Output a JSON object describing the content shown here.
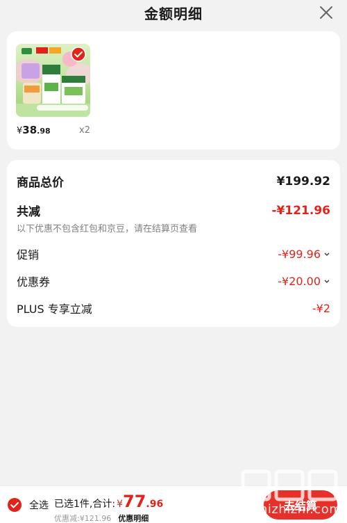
{
  "header": {
    "title": "金额明细"
  },
  "product": {
    "price_currency": "¥",
    "price_int": "38",
    "price_dec": ".98",
    "quantity": "x2"
  },
  "breakdown": {
    "total_label": "商品总价",
    "total_value": "¥199.92",
    "reduce_label": "共减",
    "reduce_value": "-¥121.96",
    "note": "以下优惠不包含红包和京豆，请在结算页查看",
    "promo_label": "促销",
    "promo_value": "-¥99.96",
    "coupon_label": "优惠券",
    "coupon_value": "-¥20.00",
    "plus_label": "PLUS 专享立减",
    "plus_value": "-¥2"
  },
  "footer": {
    "select_all": "全选",
    "selected_text": "已选1件,合计:",
    "total_currency": "¥",
    "total_int": "77",
    "total_dec": ".96",
    "discount_text": "优惠减:¥121.96",
    "detail_link": "优惠明细",
    "checkout": "去结算"
  },
  "watermark": {
    "text": "zhizhizhi.com"
  },
  "colors": {
    "accent": "#e2231a",
    "button": "#e6302a",
    "background": "#f2f2f2"
  }
}
